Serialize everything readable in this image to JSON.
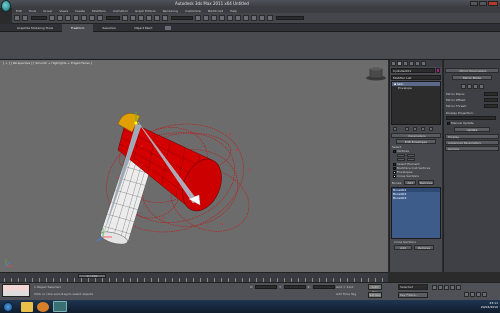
{
  "title_bar": {
    "text": "Autodesk 3ds Max 2011 x64    Untitled",
    "logo": "3ds-max-logo"
  },
  "menu": [
    "Edit",
    "Tools",
    "Group",
    "Views",
    "Create",
    "Modifiers",
    "Animation",
    "Graph Editors",
    "Rendering",
    "Customize",
    "MAXScript",
    "Help"
  ],
  "ribbon_tabs": [
    "Graphite Modeling Tools",
    "Freeform",
    "Selection",
    "Object Paint"
  ],
  "viewport": {
    "label": "[ + ] [ Perspective ] [ Smooth + Highlights + Edged Faces ]"
  },
  "command_panel": {
    "object_name": "Cylinder001",
    "modifier_list": "Modifier List",
    "stack": [
      "Skin",
      "Envelope"
    ],
    "parameters_header": "Parameters",
    "edit_envelopes": "Edit Envelopes",
    "select_label": "Select",
    "options": [
      "Vertices",
      "Select Element",
      "Backface Cull Vertices",
      "Envelopes",
      "Cross Sections"
    ],
    "bones_label": "Bones:",
    "add_label": "Add",
    "remove_label": "Remove",
    "bones_list": [
      "Bone001",
      "Bone002",
      "Bone003"
    ],
    "cross_sections": "Cross Sections",
    "add2": "Add",
    "remove2": "Remove"
  },
  "right_panel": {
    "header": "Mirror Parameters",
    "mirror_mode": "Mirror Mode",
    "rows": [
      "Mirror Plane:",
      "Mirror Offset:",
      "Mirror Thresh:"
    ],
    "display_projection": "Display Projection:",
    "manual_update": "Manual Update",
    "update": "Update",
    "rollouts": [
      "Display",
      "Advanced Parameters",
      "Gizmos"
    ]
  },
  "timeline": {
    "frame": "0 / 100"
  },
  "status": {
    "selected": "1 Object Selected",
    "prompt": "Click or click-and-drag to select objects",
    "x": "X:",
    "y": "Y:",
    "z": "Z:",
    "grid": "Grid = 10.0",
    "autokey": "Auto Key",
    "selected_opt": "Selected",
    "setkey": "Set Key",
    "key_filters": "Key Filters...",
    "add_time_tag": "Add Time Tag"
  },
  "taskbar": {
    "time": "23:11",
    "date": "20/04/2010"
  },
  "colors": {
    "accent": "#d40000",
    "viewport": "#6c6c6c",
    "panel": "#48494e"
  }
}
